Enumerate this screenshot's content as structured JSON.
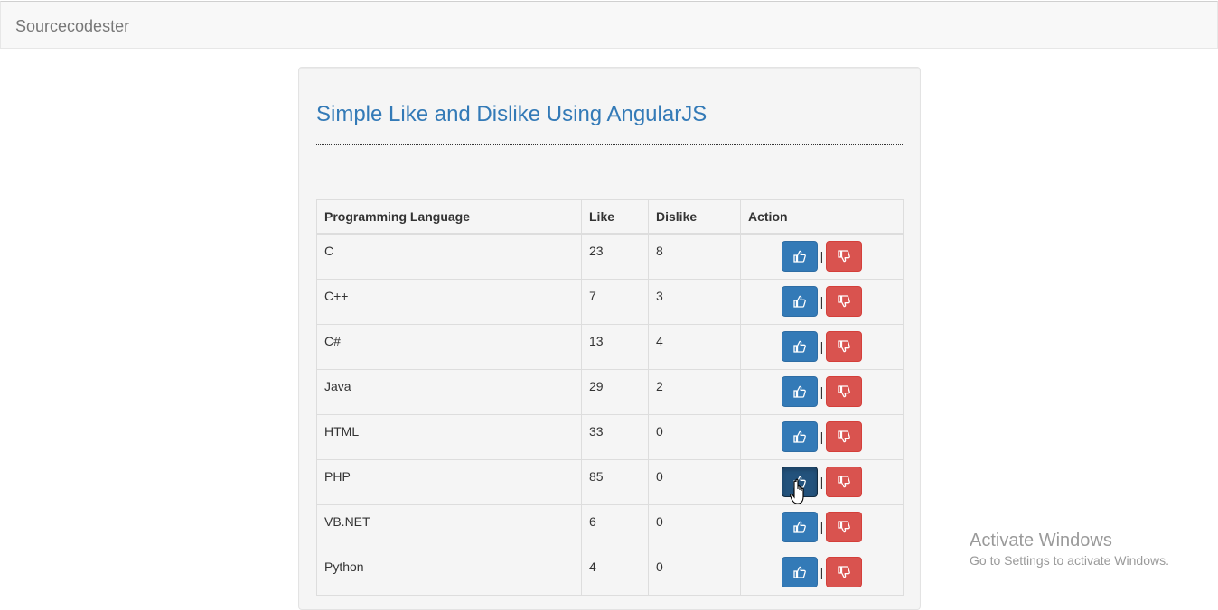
{
  "navbar": {
    "brand": "Sourcecodester"
  },
  "page": {
    "title": "Simple Like and Dislike Using AngularJS"
  },
  "table": {
    "headers": {
      "language": "Programming Language",
      "like": "Like",
      "dislike": "Dislike",
      "action": "Action"
    },
    "separator": "|",
    "rows": [
      {
        "language": "C",
        "like": "23",
        "dislike": "8"
      },
      {
        "language": "C++",
        "like": "7",
        "dislike": "3"
      },
      {
        "language": "C#",
        "like": "13",
        "dislike": "4"
      },
      {
        "language": "Java",
        "like": "29",
        "dislike": "2"
      },
      {
        "language": "HTML",
        "like": "33",
        "dislike": "0"
      },
      {
        "language": "PHP",
        "like": "85",
        "dislike": "0"
      },
      {
        "language": "VB.NET",
        "like": "6",
        "dislike": "0"
      },
      {
        "language": "Python",
        "like": "4",
        "dislike": "0"
      }
    ]
  },
  "icons": {
    "like": "thumbs-up-icon",
    "dislike": "thumbs-down-icon"
  },
  "colors": {
    "like_button": "#337ab7",
    "like_button_active": "#23527c",
    "dislike_button": "#d9534f",
    "title": "#337ab7"
  },
  "watermark": {
    "title": "Activate Windows",
    "subtitle": "Go to Settings to activate Windows."
  }
}
